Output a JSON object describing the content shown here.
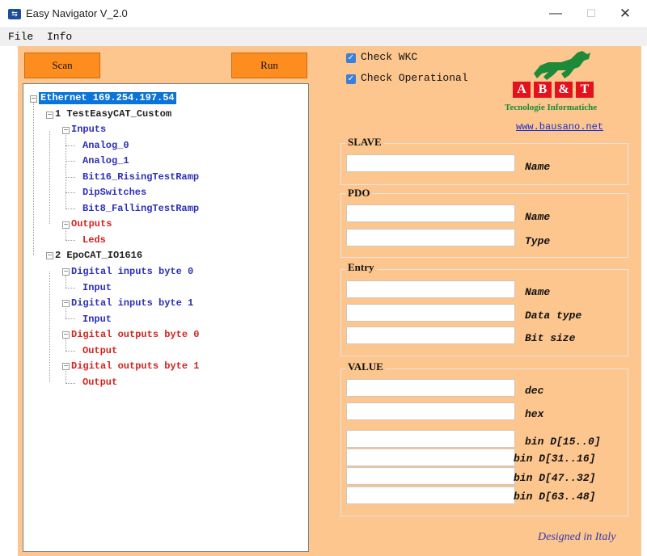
{
  "window": {
    "title": "Easy Navigator V_2.0",
    "minimize": "—",
    "maximize": "☐",
    "close": "✕"
  },
  "menu": {
    "file": "File",
    "info": "Info"
  },
  "toolbar": {
    "scan": "Scan",
    "run": "Run"
  },
  "tree": {
    "root": "Ethernet 169.254.197.54",
    "slave1": "1 TestEasyCAT_Custom",
    "inputs": "Inputs",
    "analog0": "Analog_0",
    "analog1": "Analog_1",
    "bit16": "Bit16_RisingTestRamp",
    "dip": "DipSwitches",
    "bit8": "Bit8_FallingTestRamp",
    "outputs": "Outputs",
    "leds": "Leds",
    "slave2": "2 EpoCAT_IO1616",
    "din0": "Digital inputs byte 0",
    "din0_in": "Input",
    "din1": "Digital inputs byte 1",
    "din1_in": "Input",
    "dout0": "Digital outputs byte 0",
    "dout0_out": "Output",
    "dout1": "Digital outputs byte 1",
    "dout1_out": "Output"
  },
  "checks": {
    "wkc": "Check WKC",
    "wkc_checked": true,
    "operational": "Check Operational",
    "operational_checked": true
  },
  "logo": {
    "a": "A",
    "b": "B",
    "amp": "&",
    "t": "T",
    "subtitle": "Tecnologie Informatiche",
    "link": "www.bausano.net"
  },
  "slave": {
    "title": "SLAVE",
    "name_label": "Name",
    "name_value": ""
  },
  "pdo": {
    "title": "PDO",
    "name_label": "Name",
    "type_label": "Type"
  },
  "entry": {
    "title": "Entry",
    "name_label": "Name",
    "datatype_label": "Data type",
    "bitsize_label": "Bit size"
  },
  "value": {
    "title": "VALUE",
    "dec": "dec",
    "hex": "hex",
    "bin0": "bin D[15..0]",
    "bin1": "bin D[31..16]",
    "bin2": "bin D[47..32]",
    "bin3": "bin D[63..48]"
  },
  "footer": {
    "designed": "Designed in Italy"
  },
  "colors": {
    "background": "#fcc68e",
    "button": "#fd8d1f",
    "selection": "#0a74d8",
    "tree_blue": "#2b2fb8",
    "tree_red": "#d4231e",
    "logo_red": "#e3121c",
    "logo_green": "#1d8a3a"
  }
}
